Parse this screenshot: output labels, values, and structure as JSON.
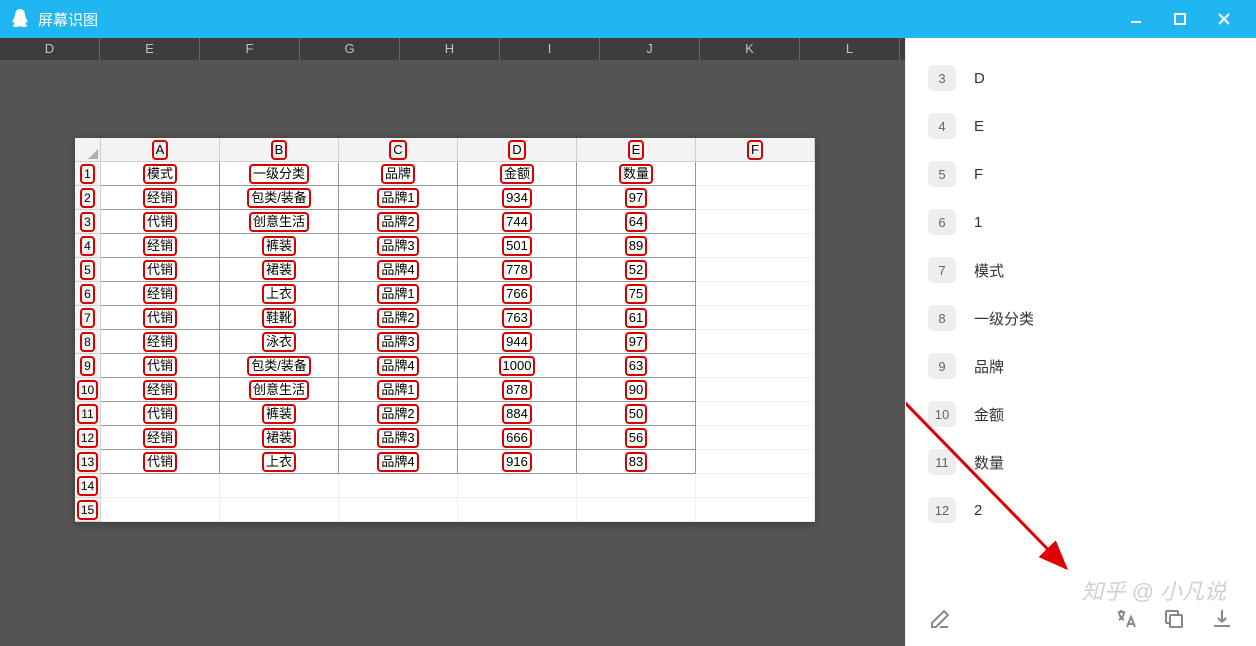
{
  "window": {
    "title": "屏幕识图",
    "minimize": "—",
    "maximize": "□",
    "close": "✕"
  },
  "bg_columns": [
    "D",
    "E",
    "F",
    "G",
    "H",
    "I",
    "J",
    "K",
    "L"
  ],
  "inner_sheet": {
    "col_headers": [
      "A",
      "B",
      "C",
      "D",
      "E",
      "F"
    ],
    "rows": [
      {
        "n": "1",
        "cells": [
          "模式",
          "一级分类",
          "品牌",
          "金额",
          "数量",
          ""
        ]
      },
      {
        "n": "2",
        "cells": [
          "经销",
          "包类/装备",
          "品牌1",
          "934",
          "97",
          ""
        ]
      },
      {
        "n": "3",
        "cells": [
          "代销",
          "创意生活",
          "品牌2",
          "744",
          "64",
          ""
        ]
      },
      {
        "n": "4",
        "cells": [
          "经销",
          "裤装",
          "品牌3",
          "501",
          "89",
          ""
        ]
      },
      {
        "n": "5",
        "cells": [
          "代销",
          "裙装",
          "品牌4",
          "778",
          "52",
          ""
        ]
      },
      {
        "n": "6",
        "cells": [
          "经销",
          "上衣",
          "品牌1",
          "766",
          "75",
          ""
        ]
      },
      {
        "n": "7",
        "cells": [
          "代销",
          "鞋靴",
          "品牌2",
          "763",
          "61",
          ""
        ]
      },
      {
        "n": "8",
        "cells": [
          "经销",
          "泳衣",
          "品牌3",
          "944",
          "97",
          ""
        ]
      },
      {
        "n": "9",
        "cells": [
          "代销",
          "包类/装备",
          "品牌4",
          "1000",
          "63",
          ""
        ]
      },
      {
        "n": "10",
        "cells": [
          "经销",
          "创意生活",
          "品牌1",
          "878",
          "90",
          ""
        ]
      },
      {
        "n": "11",
        "cells": [
          "代销",
          "裤装",
          "品牌2",
          "884",
          "50",
          ""
        ]
      },
      {
        "n": "12",
        "cells": [
          "经销",
          "裙装",
          "品牌3",
          "666",
          "56",
          ""
        ]
      },
      {
        "n": "13",
        "cells": [
          "代销",
          "上衣",
          "品牌4",
          "916",
          "83",
          ""
        ]
      },
      {
        "n": "14",
        "cells": [
          "",
          "",
          "",
          "",
          "",
          ""
        ]
      },
      {
        "n": "15",
        "cells": [
          "",
          "",
          "",
          "",
          "",
          ""
        ]
      }
    ]
  },
  "right_list": [
    {
      "num": "3",
      "text": "D"
    },
    {
      "num": "4",
      "text": "E"
    },
    {
      "num": "5",
      "text": "F"
    },
    {
      "num": "6",
      "text": "1"
    },
    {
      "num": "7",
      "text": "模式"
    },
    {
      "num": "8",
      "text": "一级分类"
    },
    {
      "num": "9",
      "text": "品牌"
    },
    {
      "num": "10",
      "text": "金额"
    },
    {
      "num": "11",
      "text": "数量"
    },
    {
      "num": "12",
      "text": "2"
    }
  ],
  "watermark": "知乎 @ 小凡说",
  "actions": {
    "edit": "edit",
    "translate": "translate",
    "copy": "copy",
    "download": "download"
  }
}
